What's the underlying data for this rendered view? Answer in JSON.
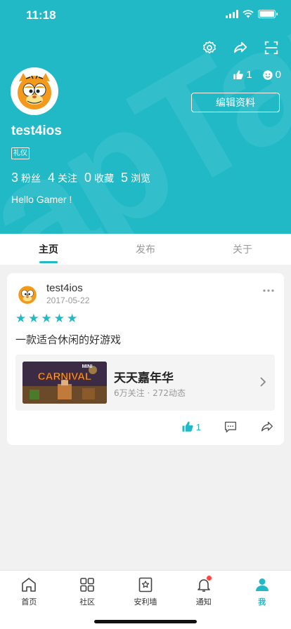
{
  "status_bar": {
    "time": "11:18"
  },
  "profile": {
    "watermark": "apTap",
    "username": "test4ios",
    "tag": "礼仪",
    "edit_label": "编辑资料",
    "likes_count": "1",
    "smile_count": "0",
    "stats": [
      {
        "num": "3",
        "label": "粉丝"
      },
      {
        "num": "4",
        "label": "关注"
      },
      {
        "num": "0",
        "label": "收藏"
      },
      {
        "num": "5",
        "label": "浏览"
      }
    ],
    "bio": "Hello Gamer !"
  },
  "tabs": [
    {
      "label": "主页",
      "active": true
    },
    {
      "label": "发布",
      "active": false
    },
    {
      "label": "关于",
      "active": false
    }
  ],
  "post": {
    "author": "test4ios",
    "date": "2017-05-22",
    "rating": 5,
    "text": "一款适合休闲的好游戏",
    "game": {
      "name": "天天嘉年华",
      "meta": "6万关注 · 272动态",
      "thumb_text": "CARNIVAL",
      "thumb_badge": "MINI"
    },
    "like_count": "1"
  },
  "bottom_nav": [
    {
      "label": "首页",
      "icon": "home-icon",
      "active": false
    },
    {
      "label": "社区",
      "icon": "community-grid-icon",
      "active": false
    },
    {
      "label": "安利墙",
      "icon": "recommend-wall-icon",
      "active": false
    },
    {
      "label": "通知",
      "icon": "bell-icon",
      "active": false
    },
    {
      "label": "我",
      "icon": "profile-icon",
      "active": true
    }
  ],
  "colors": {
    "accent": "#21b9c6",
    "badge": "#ff4444"
  }
}
